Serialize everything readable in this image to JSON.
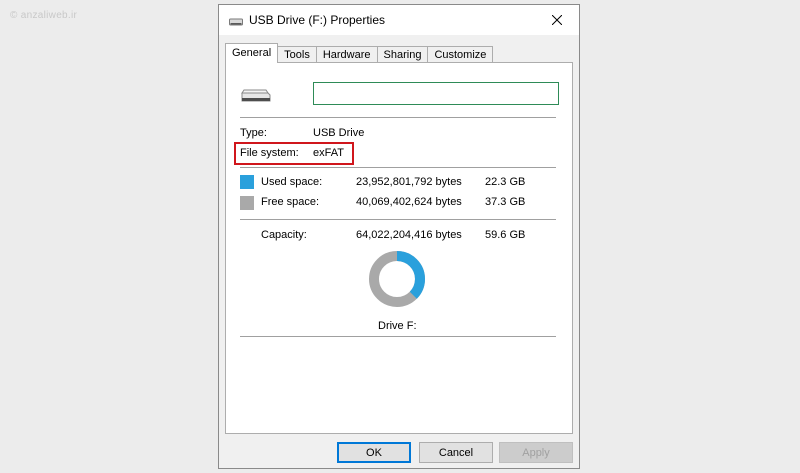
{
  "watermark": "© anzaliweb.ir",
  "window": {
    "title": "USB Drive (F:) Properties"
  },
  "tabs": [
    {
      "label": "General",
      "active": true
    },
    {
      "label": "Tools",
      "active": false
    },
    {
      "label": "Hardware",
      "active": false
    },
    {
      "label": "Sharing",
      "active": false
    },
    {
      "label": "Customize",
      "active": false
    }
  ],
  "general": {
    "drive_name_value": "",
    "type_label": "Type:",
    "type_value": "USB Drive",
    "fs_label": "File system:",
    "fs_value": "exFAT",
    "used_label": "Used space:",
    "used_bytes": "23,952,801,792 bytes",
    "used_gb": "22.3 GB",
    "free_label": "Free space:",
    "free_bytes": "40,069,402,624 bytes",
    "free_gb": "37.3 GB",
    "capacity_label": "Capacity:",
    "capacity_bytes": "64,022,204,416 bytes",
    "capacity_gb": "59.6 GB",
    "drive_label": "Drive F:",
    "used_fraction": 0.374
  },
  "colors": {
    "used": "#2aa0dc",
    "free": "#a9a9a9",
    "highlight": "#d0161c"
  },
  "buttons": {
    "ok": "OK",
    "cancel": "Cancel",
    "apply": "Apply"
  }
}
